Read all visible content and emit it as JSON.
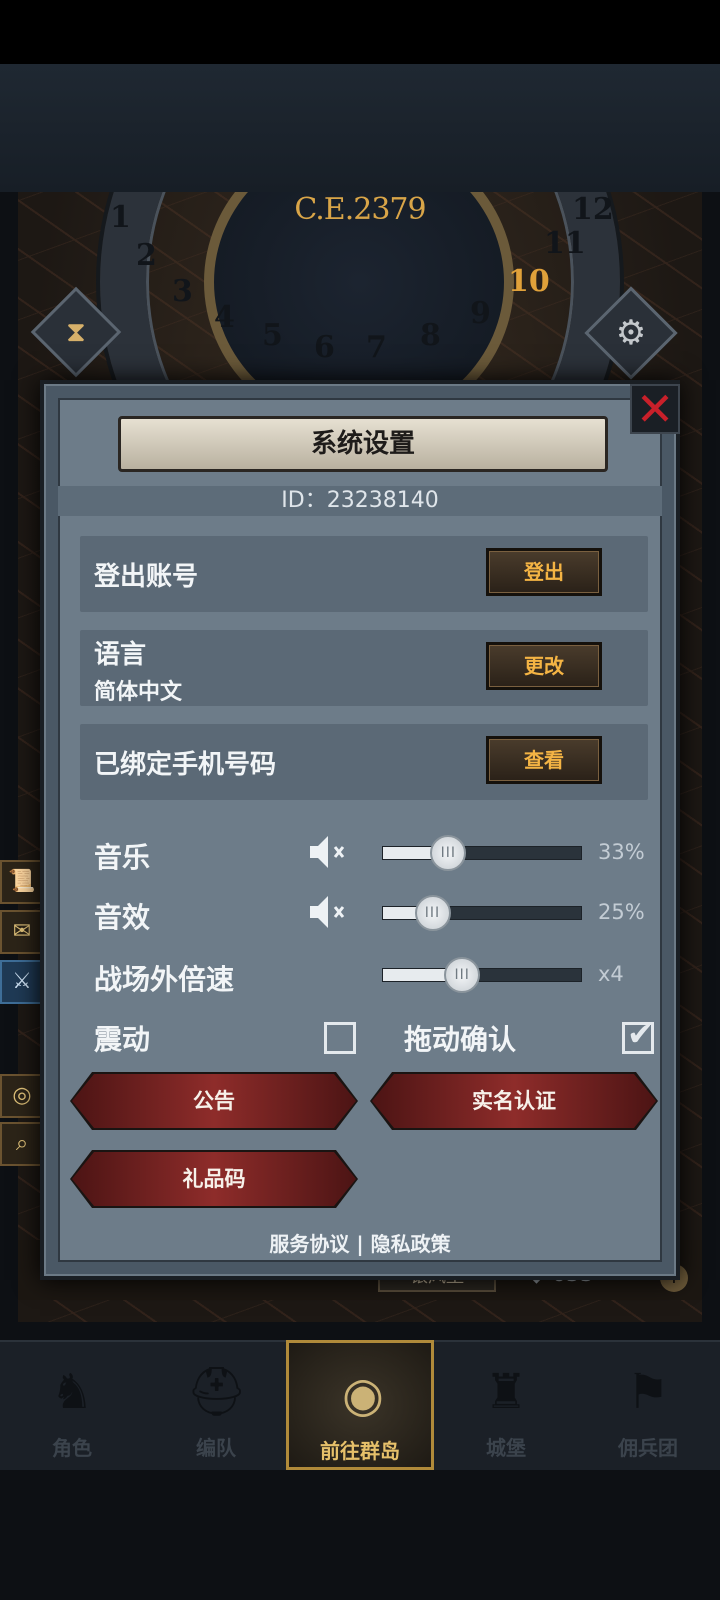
{
  "game_header": {
    "year": "C.E.2379",
    "dial_numbers": [
      "1",
      "2",
      "3",
      "4",
      "5",
      "6",
      "7",
      "8",
      "9",
      "10",
      "11",
      "12"
    ],
    "active_month": "10"
  },
  "city": {
    "name": "银风堡",
    "gems": "633"
  },
  "dialog": {
    "title": "系统设置",
    "id_text": "ID：23238140",
    "rows": {
      "logout": {
        "label": "登出账号",
        "button": "登出"
      },
      "language": {
        "label": "语言",
        "value": "简体中文",
        "button": "更改"
      },
      "phone": {
        "label": "已绑定手机号码",
        "button": "查看"
      }
    },
    "sliders": {
      "music": {
        "label": "音乐",
        "percent_text": "33%",
        "value": 0.33
      },
      "sfx": {
        "label": "音效",
        "percent_text": "25%",
        "value": 0.25
      },
      "speed": {
        "label": "战场外倍速",
        "value_text": "x4",
        "value": 0.4
      }
    },
    "toggles": {
      "vibration": {
        "label": "震动",
        "checked": false
      },
      "drag_confirm": {
        "label": "拖动确认",
        "checked": true
      }
    },
    "buttons": {
      "notice": "公告",
      "realname": "实名认证",
      "gift_code": "礼品码"
    },
    "links": {
      "terms": "服务协议",
      "separator": "|",
      "privacy": "隐私政策"
    }
  },
  "nav": {
    "items": [
      {
        "label": "角色",
        "icon": "knight-icon"
      },
      {
        "label": "编队",
        "icon": "helmet-icon"
      },
      {
        "label": "前往群岛",
        "icon": "globe-icon",
        "active": true
      },
      {
        "label": "城堡",
        "icon": "castle-icon"
      },
      {
        "label": "佣兵团",
        "icon": "banner-icon"
      }
    ]
  },
  "colors": {
    "accent_gold": "#f4b444",
    "close_red": "#c8202a",
    "button_red": "#8e2c2a"
  }
}
